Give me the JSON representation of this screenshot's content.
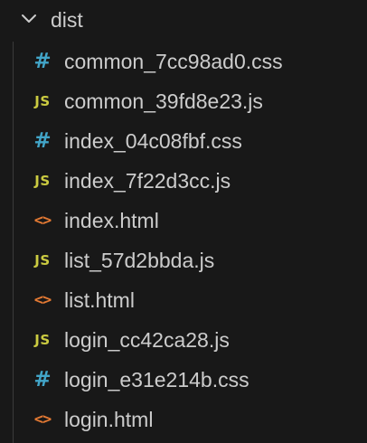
{
  "explorer": {
    "folder": {
      "name": "dist",
      "expanded": true,
      "chevron": "chevron-down-icon"
    },
    "files": [
      {
        "name": "common_7cc98ad0.css",
        "type": "css",
        "icon": "hash-icon",
        "glyph": "#",
        "color": "#42a5c8"
      },
      {
        "name": "common_39fd8e23.js",
        "type": "js",
        "icon": "js-icon",
        "glyph": "JS",
        "color": "#cbcb41"
      },
      {
        "name": "index_04c08fbf.css",
        "type": "css",
        "icon": "hash-icon",
        "glyph": "#",
        "color": "#42a5c8"
      },
      {
        "name": "index_7f22d3cc.js",
        "type": "js",
        "icon": "js-icon",
        "glyph": "JS",
        "color": "#cbcb41"
      },
      {
        "name": "index.html",
        "type": "html",
        "icon": "html-icon",
        "glyph": "<>",
        "color": "#e37933"
      },
      {
        "name": "list_57d2bbda.js",
        "type": "js",
        "icon": "js-icon",
        "glyph": "JS",
        "color": "#cbcb41"
      },
      {
        "name": "list.html",
        "type": "html",
        "icon": "html-icon",
        "glyph": "<>",
        "color": "#e37933"
      },
      {
        "name": "login_cc42ca28.js",
        "type": "js",
        "icon": "js-icon",
        "glyph": "JS",
        "color": "#cbcb41"
      },
      {
        "name": "login_e31e214b.css",
        "type": "css",
        "icon": "hash-icon",
        "glyph": "#",
        "color": "#42a5c8"
      },
      {
        "name": "login.html",
        "type": "html",
        "icon": "html-icon",
        "glyph": "<>",
        "color": "#e37933"
      }
    ]
  },
  "theme": {
    "background": "#181818",
    "text": "#cccccc",
    "indent_guide": "#3a3a3a"
  }
}
